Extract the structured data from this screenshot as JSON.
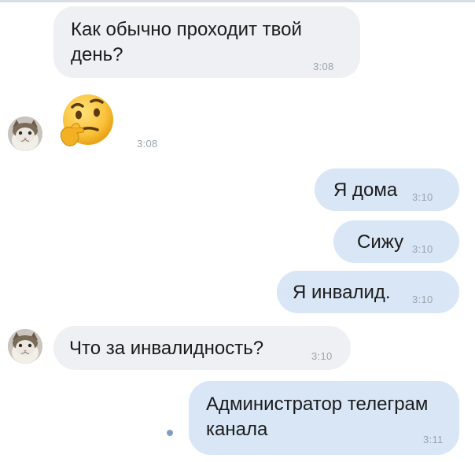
{
  "messages": [
    {
      "from": "other",
      "text": "Как обычно проходит твой\nдень?",
      "time": "3:08"
    },
    {
      "from": "other",
      "emoji": "thinking-face",
      "time": "3:08"
    },
    {
      "from": "me",
      "text": "Я дома",
      "time": "3:10"
    },
    {
      "from": "me",
      "text": "Сижу",
      "time": "3:10"
    },
    {
      "from": "me",
      "text": "Я инвалид.",
      "time": "3:10"
    },
    {
      "from": "other",
      "text": "Что за инвалидность?",
      "time": "3:10"
    },
    {
      "from": "me",
      "text": "Администратор телеграм\nканала",
      "time": "3:11",
      "unread": true
    }
  ],
  "colors": {
    "incoming_bubble": "#eef0f3",
    "outgoing_bubble": "#d8e6f6",
    "timestamp": "#9aa4ae",
    "unread_dot": "#7f9fc2"
  },
  "icons": {
    "avatar": "cat-avatar",
    "emoji": "thinking-face-icon",
    "unread": "unread-dot-icon"
  }
}
